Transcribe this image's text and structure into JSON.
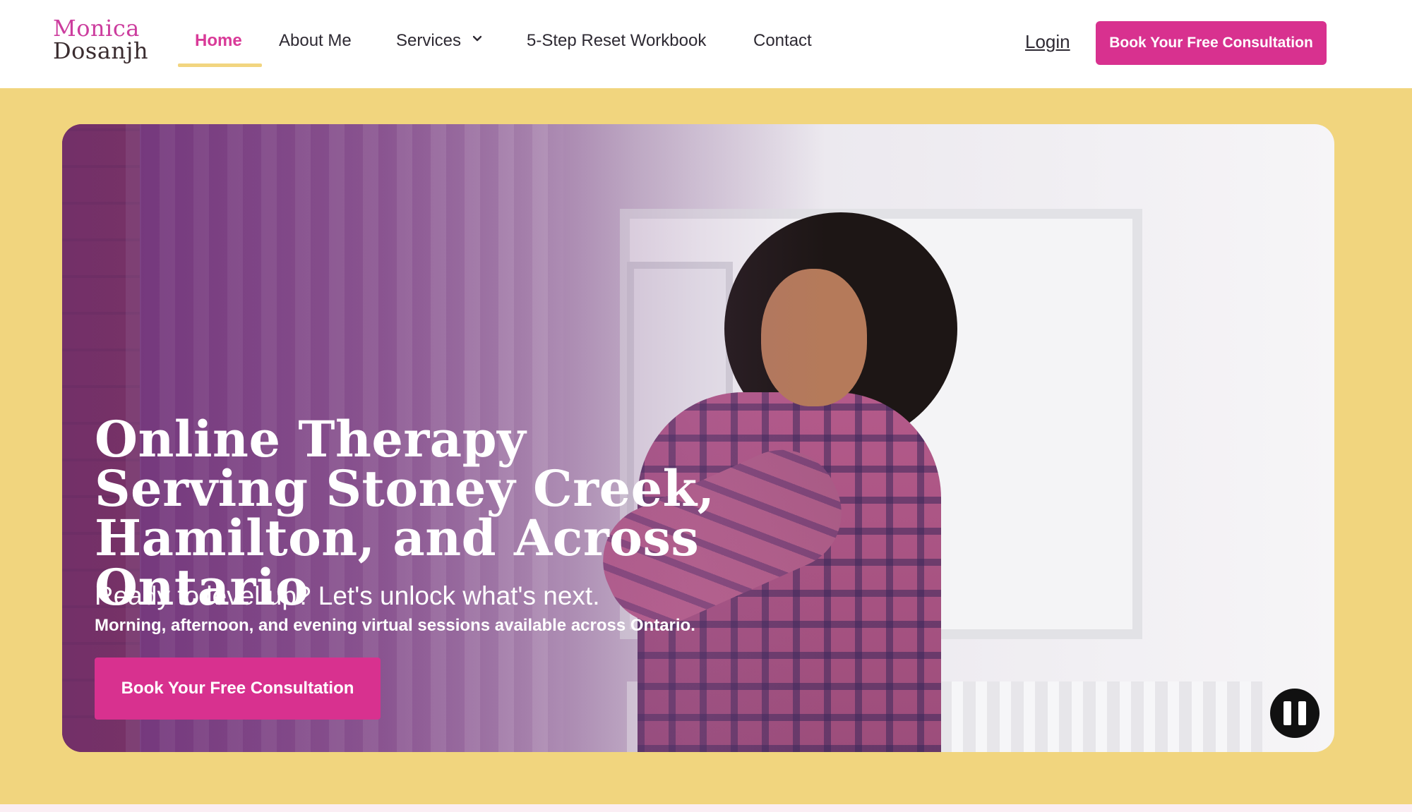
{
  "header": {
    "logo": {
      "line1": "Monica",
      "line2": "Dosanjh"
    },
    "nav": [
      {
        "label": "Home",
        "active": true
      },
      {
        "label": "About Me"
      },
      {
        "label": "Services",
        "has_dropdown": true
      },
      {
        "label": "5-Step Reset Workbook"
      },
      {
        "label": "Contact"
      }
    ],
    "login_label": "Login",
    "cta_label": "Book Your Free Consultation"
  },
  "hero": {
    "title": "Online Therapy Serving Stoney Creek, Hamilton, and Across Ontario",
    "subtitle": "Ready to level up? Let's unlock what's next.",
    "note": "Morning, afternoon, and evening virtual sessions available across Ontario.",
    "cta_label": "Book Your Free Consultation",
    "video_control": "pause-icon"
  },
  "colors": {
    "brand_pink": "#d8318f",
    "accent_yellow": "#f1d57e",
    "logo_pink": "#cc3d9e",
    "text_dark": "#2e2a33"
  }
}
